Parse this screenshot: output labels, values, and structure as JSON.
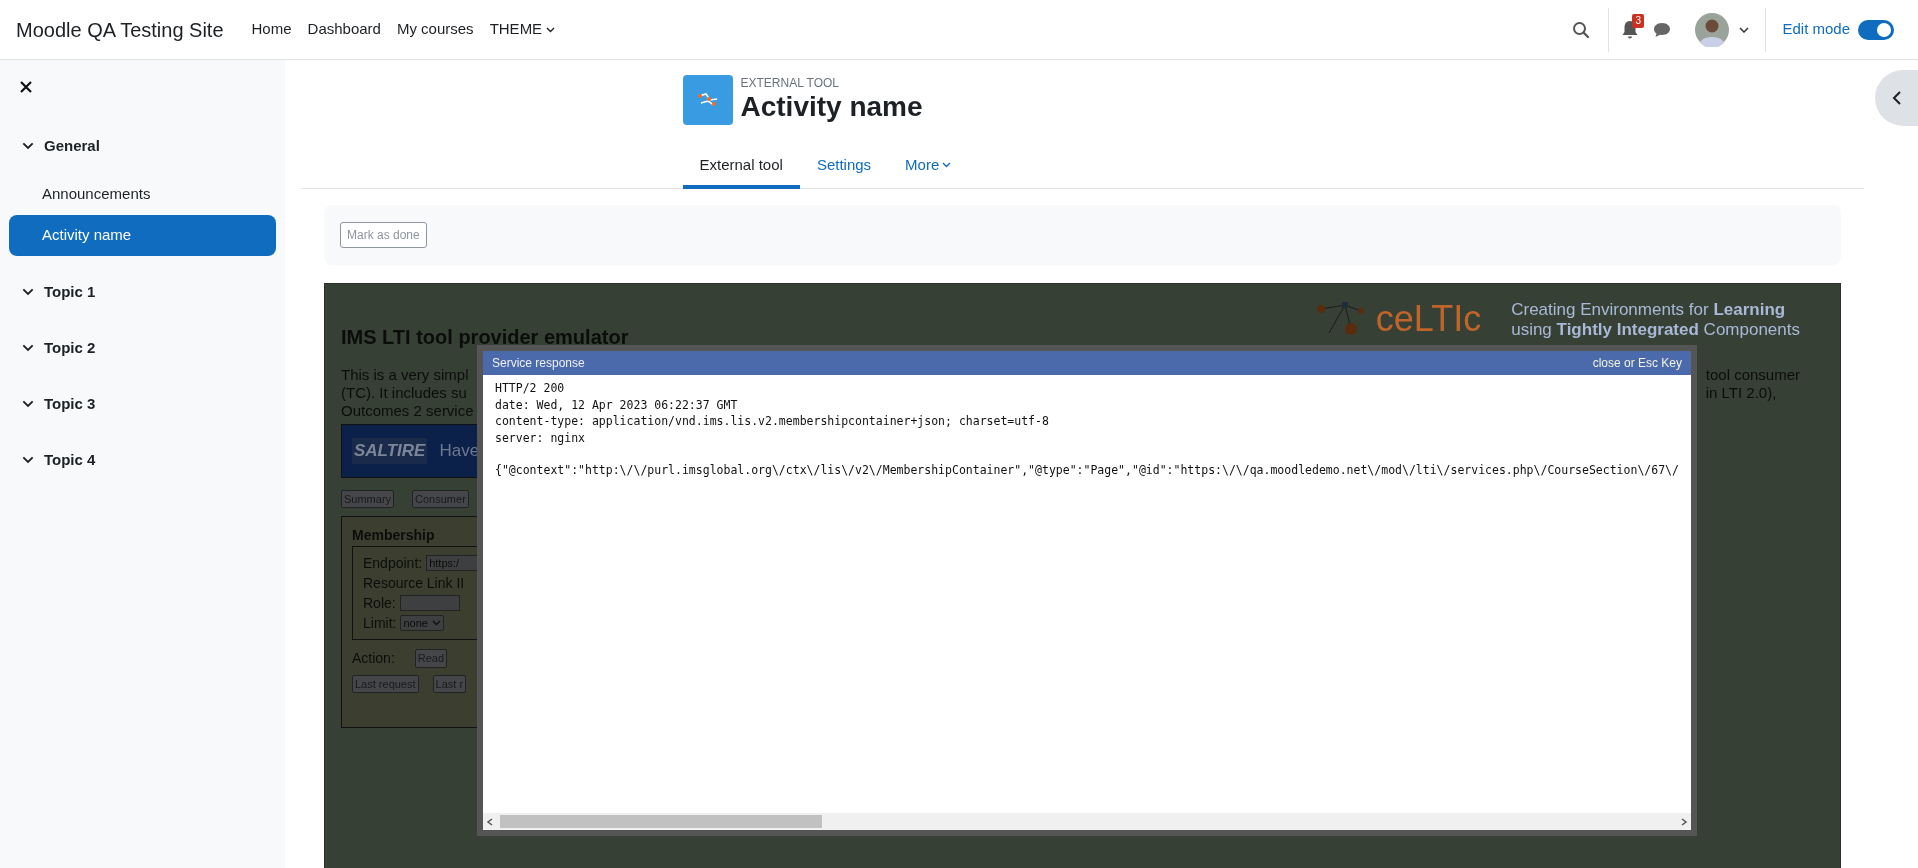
{
  "navbar": {
    "site_name": "Moodle QA Testing Site",
    "links": [
      {
        "label": "Home",
        "kind": "link"
      },
      {
        "label": "Dashboard",
        "kind": "link"
      },
      {
        "label": "My courses",
        "kind": "link"
      },
      {
        "label": "THEME",
        "kind": "dropdown"
      }
    ],
    "notification_count": "3",
    "edit_mode": {
      "label": "Edit mode",
      "on": true
    }
  },
  "course_index": {
    "sections": [
      {
        "label": "General",
        "children": [
          {
            "label": "Announcements",
            "selected": false
          },
          {
            "label": "Activity name",
            "selected": true
          }
        ]
      },
      {
        "label": "Topic 1"
      },
      {
        "label": "Topic 2"
      },
      {
        "label": "Topic 3"
      },
      {
        "label": "Topic 4"
      }
    ]
  },
  "activity_header": {
    "type_label": "EXTERNAL TOOL",
    "title": "Activity name"
  },
  "tabs": [
    {
      "label": "External tool",
      "selected": true,
      "kind": "tab"
    },
    {
      "label": "Settings",
      "selected": false,
      "kind": "tab"
    },
    {
      "label": "More",
      "selected": false,
      "kind": "dropdown"
    }
  ],
  "completion": {
    "button": "Mark as done"
  },
  "tool_frame": {
    "heading": "IMS LTI tool provider emulator",
    "logo_text": "ceLTIc",
    "tagline": [
      "Creating Environments for **Learning**",
      "using **Tightly Integrated** Components"
    ],
    "intro_left": [
      "This is a very simpl",
      "(TC). It includes su",
      "Outcomes 2 service"
    ],
    "intro_right": [
      "tool consumer",
      "in LTI 2.0),"
    ],
    "banner": {
      "logo_text": "SALTIRE",
      "text": "Have"
    },
    "tab_buttons": [
      "Summary",
      "Consumer"
    ],
    "membership": {
      "title": "Membership",
      "fields": [
        {
          "kind": "input",
          "label": "Endpoint:",
          "value": "https:/"
        },
        {
          "kind": "text",
          "label": "Resource Link II"
        },
        {
          "kind": "input",
          "label": "Role:"
        },
        {
          "kind": "select",
          "label": "Limit:",
          "value": "none"
        }
      ],
      "action_label": "Action:",
      "action_button": "Read",
      "request_buttons": [
        "Last request",
        "Last r"
      ]
    }
  },
  "modal": {
    "title": "Service response",
    "close_label": "close or Esc Key",
    "headers": [
      "HTTP/2 200",
      "date: Wed, 12 Apr 2023 06:22:37 GMT",
      "content-type: application/vnd.ims.lis.v2.membershipcontainer+json; charset=utf-8",
      "server: nginx"
    ],
    "body": "{\"@context\":\"http:\\/\\/purl.imsglobal.org\\/ctx\\/lis\\/v2\\/MembershipContainer\",\"@type\":\"Page\",\"@id\":\"https:\\/\\/qa.moodledemo.net\\/mod\\/lti\\/services.php\\/CourseSection\\/67\\/"
  }
}
